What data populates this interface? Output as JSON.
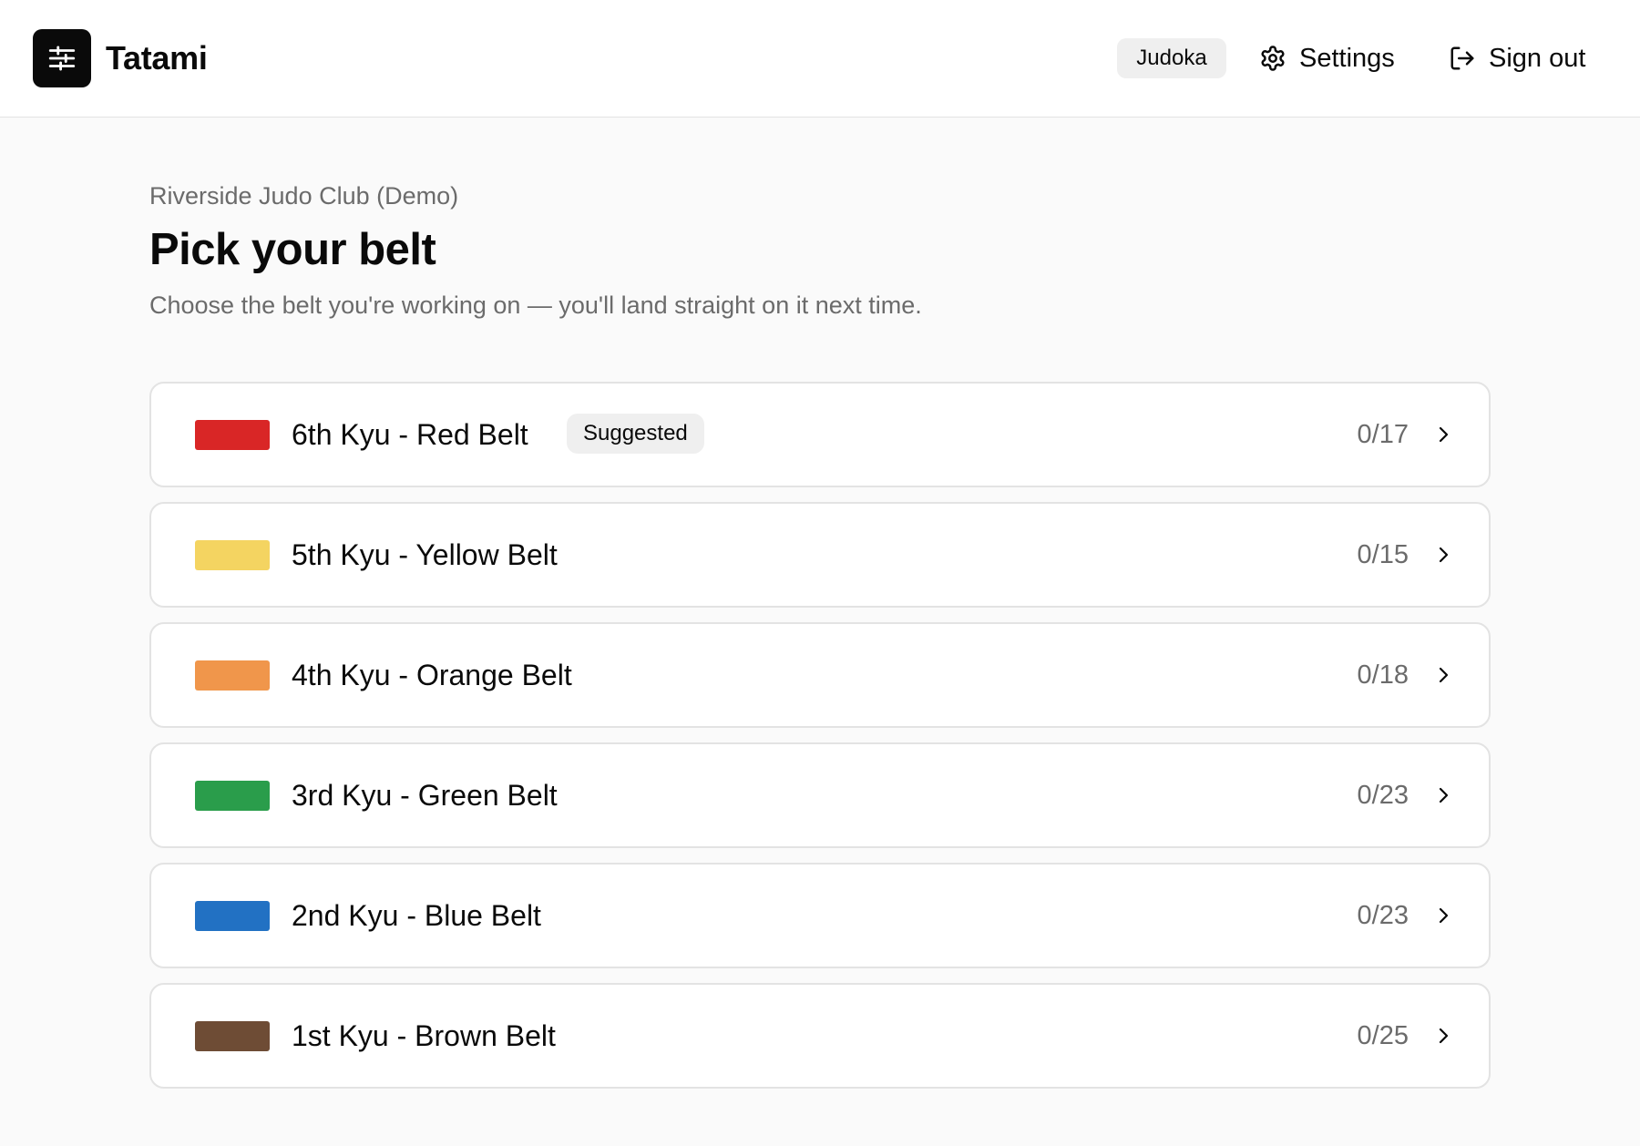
{
  "header": {
    "app_name": "Tatami",
    "logo_icon": "sliders-icon",
    "role_badge": "Judoka",
    "settings_label": "Settings",
    "settings_icon": "gear-icon",
    "signout_label": "Sign out",
    "signout_icon": "log-out-icon"
  },
  "main": {
    "club_name": "Riverside Judo Club (Demo)",
    "title": "Pick your belt",
    "subtitle": "Choose the belt you're working on — you'll land straight on it next time."
  },
  "belts": [
    {
      "label": "6th Kyu - Red Belt",
      "color": "#d92626",
      "progress": "0/17",
      "badge": "Suggested"
    },
    {
      "label": "5th Kyu - Yellow Belt",
      "color": "#f4d461",
      "progress": "0/15"
    },
    {
      "label": "4th Kyu - Orange Belt",
      "color": "#f0964b",
      "progress": "0/18"
    },
    {
      "label": "3rd Kyu - Green Belt",
      "color": "#2a9d4b",
      "progress": "0/23"
    },
    {
      "label": "2nd Kyu - Blue Belt",
      "color": "#2271c3",
      "progress": "0/23"
    },
    {
      "label": "1st Kyu - Brown Belt",
      "color": "#6e4c35",
      "progress": "0/25"
    }
  ]
}
